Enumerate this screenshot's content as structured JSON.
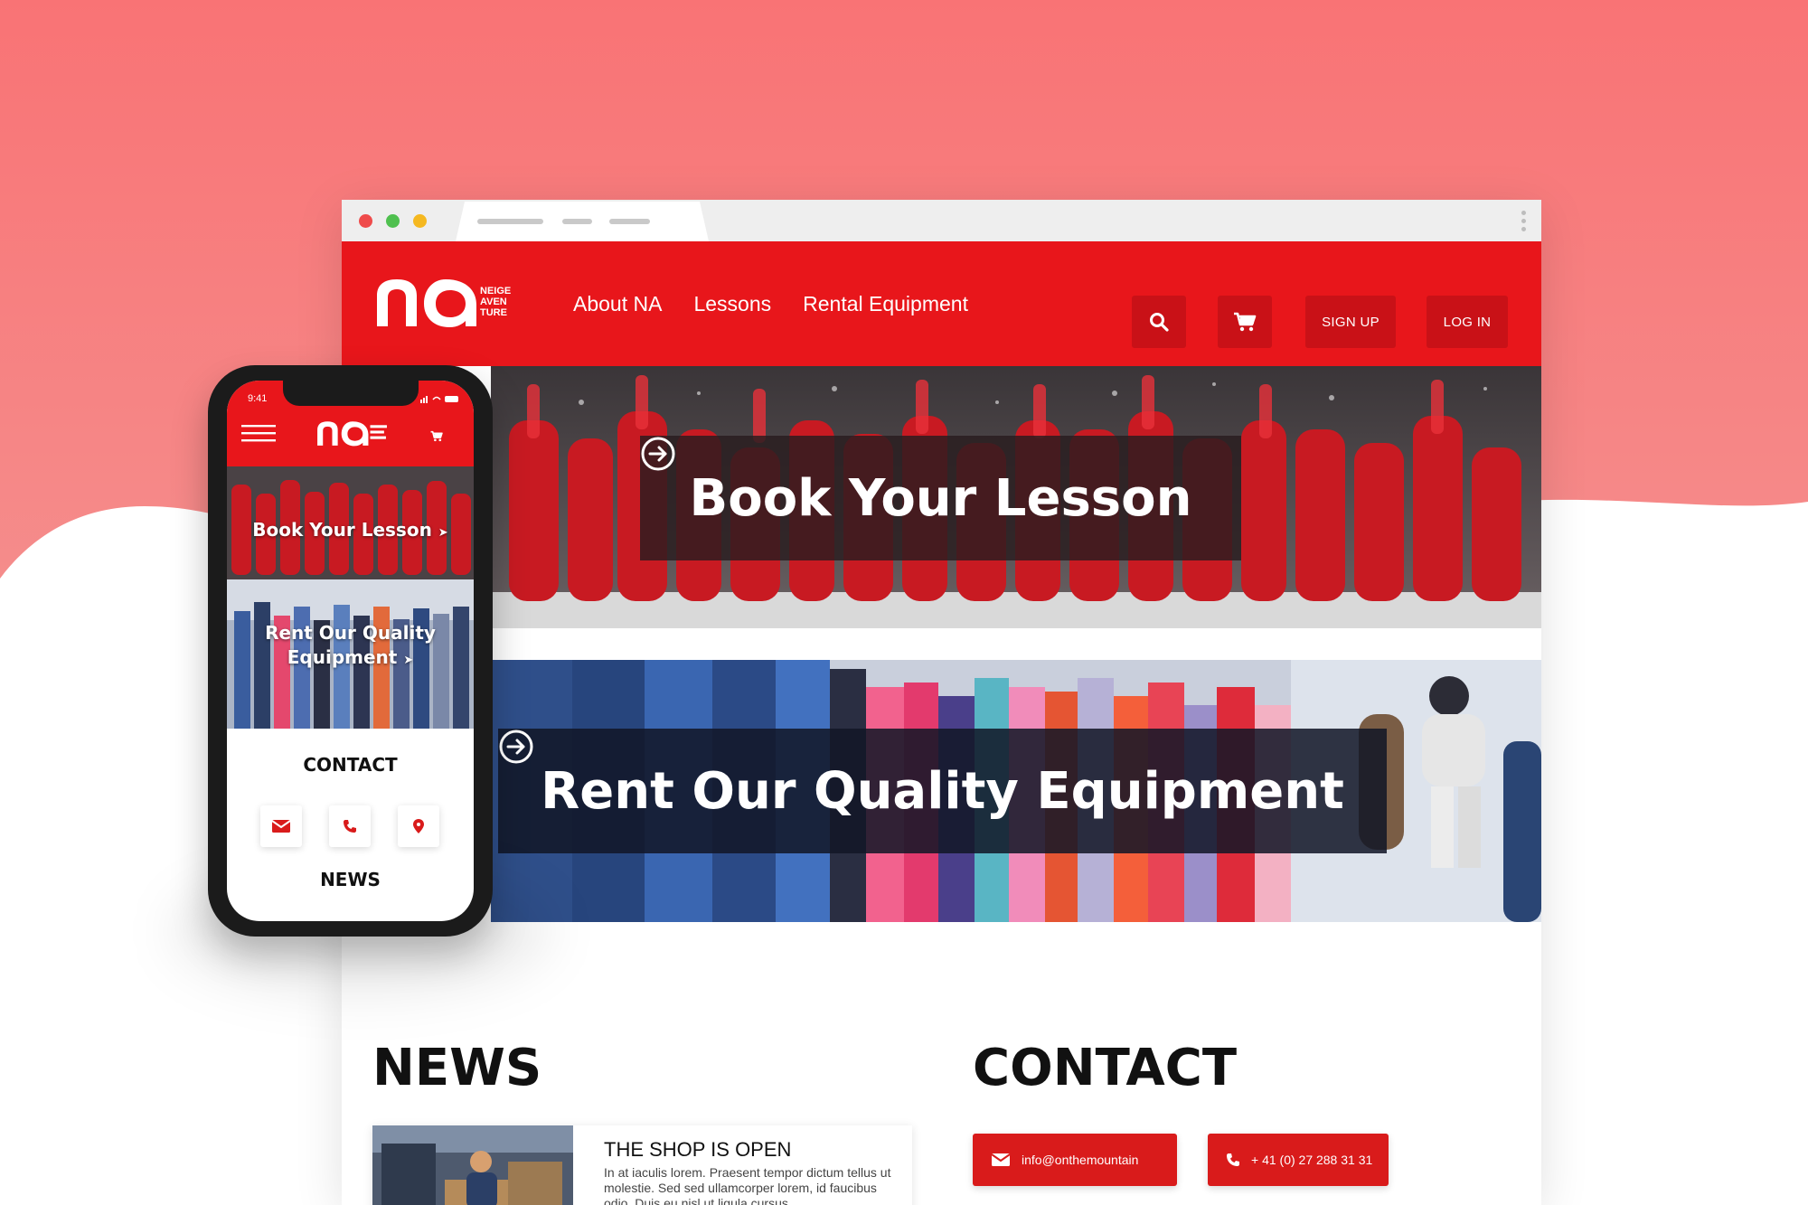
{
  "colors": {
    "brand_red": "#e8161b",
    "button_red": "#c91117",
    "background_coral": "#f8777a"
  },
  "browser": {
    "nav": {
      "links": [
        "About NA",
        "Lessons",
        "Rental Equipment"
      ],
      "sign_up": "SIGN UP",
      "log_in": "LOG IN"
    },
    "logo": {
      "mark": "na",
      "words": [
        "NEIGE",
        "AVEN",
        "TURE"
      ]
    },
    "banners": {
      "lesson": "Book Your Lesson",
      "rent": "Rent Our Quality Equipment"
    },
    "news": {
      "title": "NEWS",
      "card_title": "THE SHOP IS OPEN",
      "card_body": "In at iaculis lorem. Praesent tempor dictum tellus ut molestie. Sed sed ullamcorper lorem, id faucibus odio. Duis eu nisl ut ligula cursus"
    },
    "contact": {
      "title": "CONTACT",
      "email": "info@onthemountain",
      "phone": "+ 41 (0) 27 288 31 31"
    }
  },
  "phone": {
    "time": "9:41",
    "banners": {
      "lesson": "Book Your Lesson",
      "rent_line1": "Rent Our Quality",
      "rent_line2": "Equipment"
    },
    "contact_title": "CONTACT",
    "news_title": "NEWS"
  }
}
